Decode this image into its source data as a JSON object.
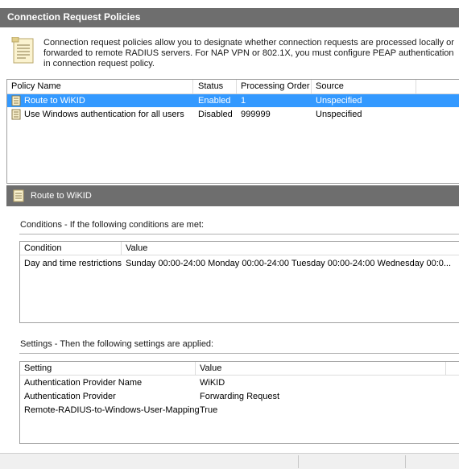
{
  "header": {
    "title": "Connection Request Policies"
  },
  "info": {
    "icon": "policy-document-icon",
    "text": "Connection request policies allow you to designate whether connection requests are processed locally or forwarded to remote RADIUS servers. For NAP VPN or 802.1X, you must configure PEAP authentication in connection request policy."
  },
  "policy_table": {
    "columns": [
      "Policy Name",
      "Status",
      "Processing Order",
      "Source"
    ],
    "rows": [
      {
        "name": "Route to WiKID",
        "status": "Enabled",
        "order": "1",
        "source": "Unspecified",
        "selected": true
      },
      {
        "name": "Use Windows authentication for all users",
        "status": "Disabled",
        "order": "999999",
        "source": "Unspecified",
        "selected": false
      }
    ]
  },
  "detail": {
    "title": "Route to WiKID",
    "conditions": {
      "label": "Conditions - If the following conditions are met:",
      "columns": [
        "Condition",
        "Value"
      ],
      "rows": [
        {
          "condition": "Day and time restrictions",
          "value": "Sunday 00:00-24:00 Monday 00:00-24:00 Tuesday 00:00-24:00 Wednesday 00:0..."
        }
      ]
    },
    "settings": {
      "label": "Settings - Then the following settings are applied:",
      "columns": [
        "Setting",
        "Value"
      ],
      "rows": [
        {
          "setting": "Authentication Provider Name",
          "value": "WiKID"
        },
        {
          "setting": "Authentication Provider",
          "value": "Forwarding Request"
        },
        {
          "setting": "Remote-RADIUS-to-Windows-User-Mapping",
          "value": "True"
        }
      ]
    }
  },
  "colors": {
    "header_bg": "#6e6e6e",
    "selection": "#3399ff"
  }
}
